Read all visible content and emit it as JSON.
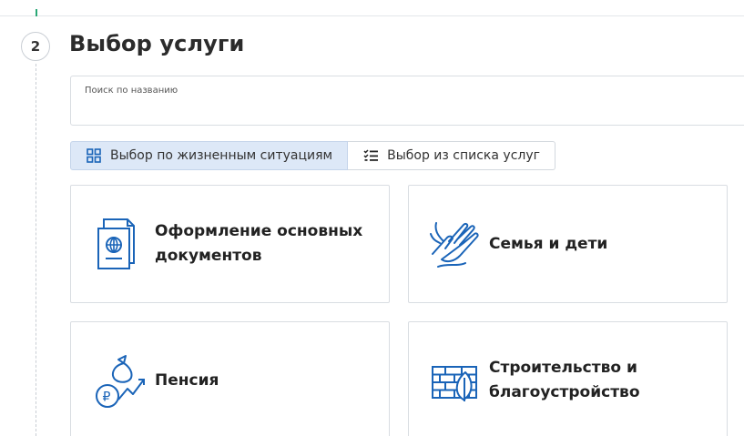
{
  "step": {
    "number": "2",
    "title": "Выбор услуги"
  },
  "search": {
    "label": "Поиск по названию"
  },
  "tabs": [
    {
      "label": "Выбор по жизненным ситуациям",
      "icon": "grid-icon",
      "active": true
    },
    {
      "label": "Выбор из списка услуг",
      "icon": "list-icon",
      "active": false
    }
  ],
  "cards": [
    {
      "label": "Оформление основных документов",
      "icon": "passport-icon"
    },
    {
      "label": "Семья и дети",
      "icon": "hands-icon"
    },
    {
      "label": "Пенсия",
      "icon": "pension-icon"
    },
    {
      "label": "Строительство и благоустройство",
      "icon": "brick-wall-icon"
    }
  ],
  "colors": {
    "accent": "#1a64b8",
    "active_tab_bg": "#dde8f7",
    "border": "#d9dde2",
    "progress_tick": "#2aa876"
  }
}
